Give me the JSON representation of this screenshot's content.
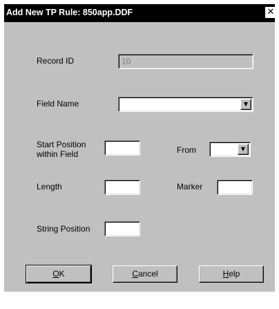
{
  "window": {
    "title": "Add New TP Rule: 850app.DDF",
    "close_glyph": "✕"
  },
  "form": {
    "record_id": {
      "label": "Record ID",
      "value": "10"
    },
    "field_name": {
      "label": "Field Name",
      "value": ""
    },
    "start_position": {
      "label_line1": "Start Position",
      "label_line2": "within Field",
      "value": ""
    },
    "from": {
      "label": "From",
      "value": ""
    },
    "length": {
      "label": "Length",
      "value": ""
    },
    "marker": {
      "label": "Marker",
      "value": ""
    },
    "string_position": {
      "label": "String Position",
      "value": ""
    }
  },
  "buttons": {
    "ok": {
      "mnemonic": "O",
      "rest": "K"
    },
    "cancel": {
      "mnemonic": "C",
      "rest": "ancel"
    },
    "help": {
      "mnemonic": "H",
      "rest": "elp"
    }
  },
  "icons": {
    "dropdown_arrow": "▼"
  }
}
